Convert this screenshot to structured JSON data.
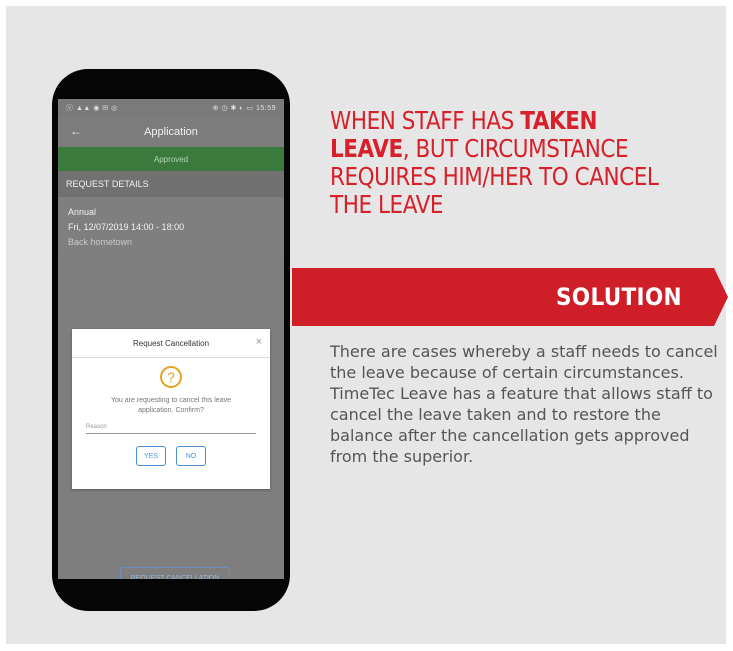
{
  "phone": {
    "status_left": "ⓥ ▲▲ ◉ ✉ ◎",
    "status_right": "⊕ ◷ ✱ ◐ ▭ 15:59",
    "app_title": "Application",
    "back_icon": "arrow-left-icon",
    "status_banner": "Approved",
    "section_header": "REQUEST DETAILS",
    "leave_type": "Annual",
    "leave_datetime": "Fri, 12/07/2019 14:00 - 18:00",
    "leave_reason": "Back hometown",
    "dialog": {
      "title": "Request Cancellation",
      "close_icon": "close-icon",
      "question_icon": "?",
      "message": "You are requesting to cancel this leave application. Confirm?",
      "reason_placeholder": "Reason",
      "yes_label": "YES",
      "no_label": "NO"
    },
    "request_button_label": "REQUEST CANCELLATION"
  },
  "headline": {
    "part1": "WHEN STAFF HAS ",
    "bold": "TAKEN LEAVE",
    "part2": ", BUT CIRCUMSTANCE REQUIRES HIM/HER TO CANCEL THE LEAVE"
  },
  "solution_label": "SOLUTION",
  "body_text": "There are cases whereby a staff needs to cancel the leave because of certain circumstances. TimeTec Leave has a feature that allows staff to cancel the leave taken and to restore the balance after the cancellation gets approved from the superior.",
  "colors": {
    "accent_red": "#cf1e28",
    "approved_green": "#3a7a3c",
    "panel_gray": "#e6e6e7"
  }
}
